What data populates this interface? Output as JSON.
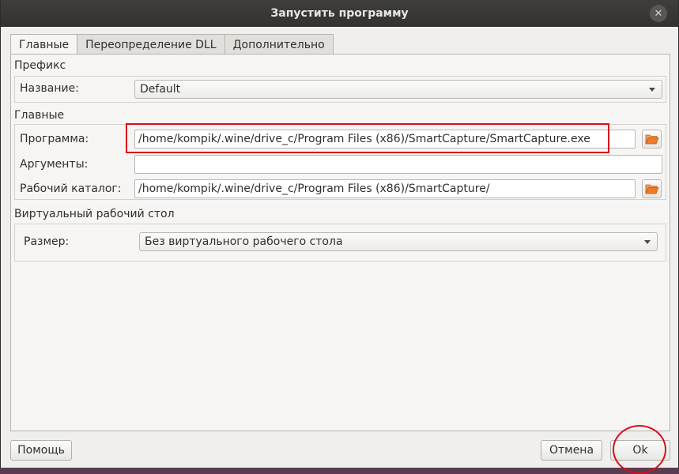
{
  "window": {
    "title": "Запустить программу",
    "close_icon": "close-icon"
  },
  "tabs": [
    {
      "label": "Главные",
      "active": true
    },
    {
      "label": "Переопределение DLL",
      "active": false
    },
    {
      "label": "Дополнительно",
      "active": false
    }
  ],
  "prefix": {
    "section_title": "Префикс",
    "name_label": "Название:",
    "name_value": "Default"
  },
  "general": {
    "section_title": "Главные",
    "program_label": "Программа:",
    "program_value": "/home/kompik/.wine/drive_c/Program Files (x86)/SmartCapture/SmartCapture.exe",
    "arguments_label": "Аргументы:",
    "arguments_value": "",
    "workdir_label": "Рабочий каталог:",
    "workdir_value": "/home/kompik/.wine/drive_c/Program Files (x86)/SmartCapture/",
    "browse_icon": "folder-open-icon"
  },
  "virtual_desktop": {
    "section_title": "Виртуальный рабочий стол",
    "size_label": "Размер:",
    "size_value": "Без виртуального рабочего стола"
  },
  "buttons": {
    "help": "Помощь",
    "cancel": "Отмена",
    "ok": "Ok"
  },
  "colors": {
    "titlebar": "#3a3936",
    "annotation": "#d60f1a",
    "panel": "#f6f5f4"
  }
}
